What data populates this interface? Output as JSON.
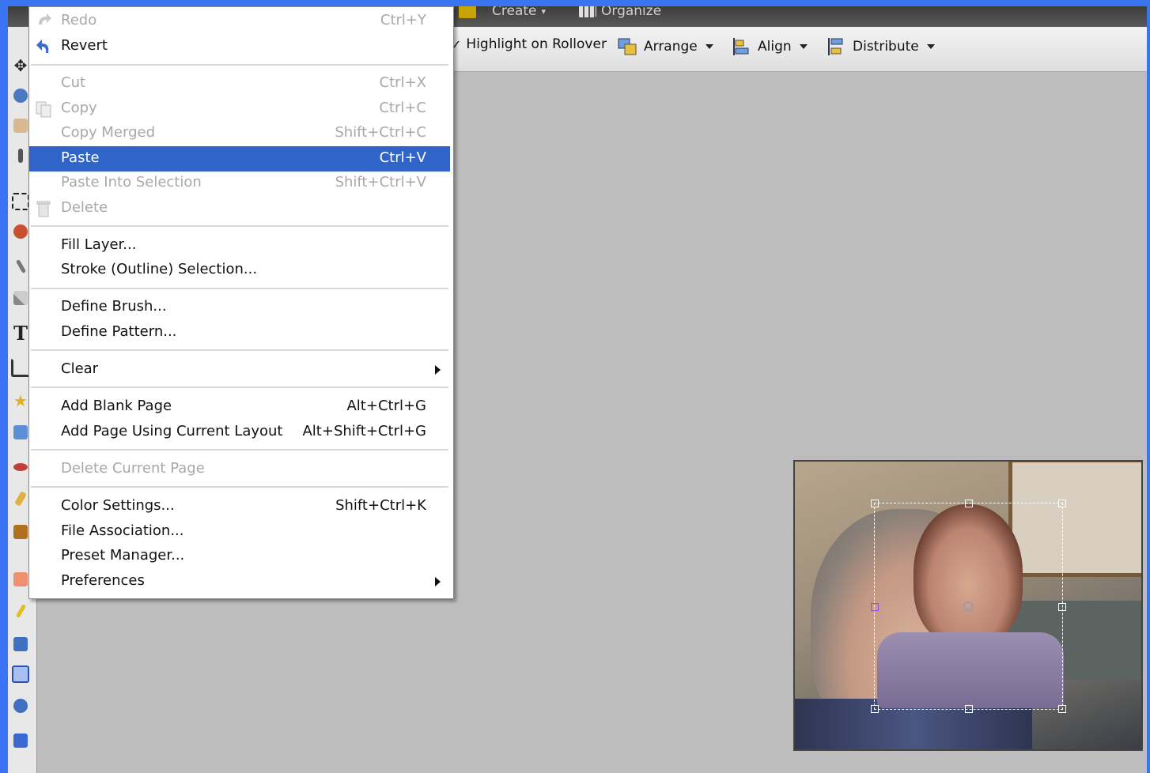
{
  "topbar": {
    "create_label": "Create",
    "organize_label": "Organize"
  },
  "options_bar": {
    "highlight_label": "Highlight on Rollover",
    "arrange_label": "Arrange",
    "align_label": "Align",
    "distribute_label": "Distribute"
  },
  "edit_menu": {
    "items": [
      {
        "label": "Redo",
        "shortcut": "Ctrl+Y",
        "enabled": false,
        "icon": "redo-icon"
      },
      {
        "label": "Revert",
        "shortcut": "",
        "enabled": true,
        "icon": "revert-icon"
      },
      {
        "label": "Cut",
        "shortcut": "Ctrl+X",
        "enabled": false
      },
      {
        "label": "Copy",
        "shortcut": "Ctrl+C",
        "enabled": false,
        "icon": "copy-icon"
      },
      {
        "label": "Copy Merged",
        "shortcut": "Shift+Ctrl+C",
        "enabled": false
      },
      {
        "label": "Paste",
        "shortcut": "Ctrl+V",
        "enabled": true,
        "selected": true
      },
      {
        "label": "Paste Into Selection",
        "shortcut": "Shift+Ctrl+V",
        "enabled": false
      },
      {
        "label": "Delete",
        "shortcut": "",
        "enabled": false,
        "icon": "trash-icon"
      },
      {
        "label": "Fill Layer...",
        "shortcut": "",
        "enabled": true
      },
      {
        "label": "Stroke (Outline) Selection...",
        "shortcut": "",
        "enabled": true
      },
      {
        "label": "Define Brush...",
        "shortcut": "",
        "enabled": true
      },
      {
        "label": "Define Pattern...",
        "shortcut": "",
        "enabled": true
      },
      {
        "label": "Clear",
        "shortcut": "",
        "enabled": true,
        "submenu": true
      },
      {
        "label": "Add Blank Page",
        "shortcut": "Alt+Ctrl+G",
        "enabled": true
      },
      {
        "label": "Add Page Using Current Layout",
        "shortcut": "Alt+Shift+Ctrl+G",
        "enabled": true
      },
      {
        "label": "Delete Current Page",
        "shortcut": "",
        "enabled": false
      },
      {
        "label": "Color Settings...",
        "shortcut": "Shift+Ctrl+K",
        "enabled": true
      },
      {
        "label": "File Association...",
        "shortcut": "",
        "enabled": true
      },
      {
        "label": "Preset Manager...",
        "shortcut": "",
        "enabled": true
      },
      {
        "label": "Preferences",
        "shortcut": "",
        "enabled": true,
        "submenu": true
      }
    ]
  },
  "colors": {
    "selection_highlight": "#3164c8",
    "canvas_background": "#bdbdbd",
    "desktop_border": "#3a74f0"
  }
}
